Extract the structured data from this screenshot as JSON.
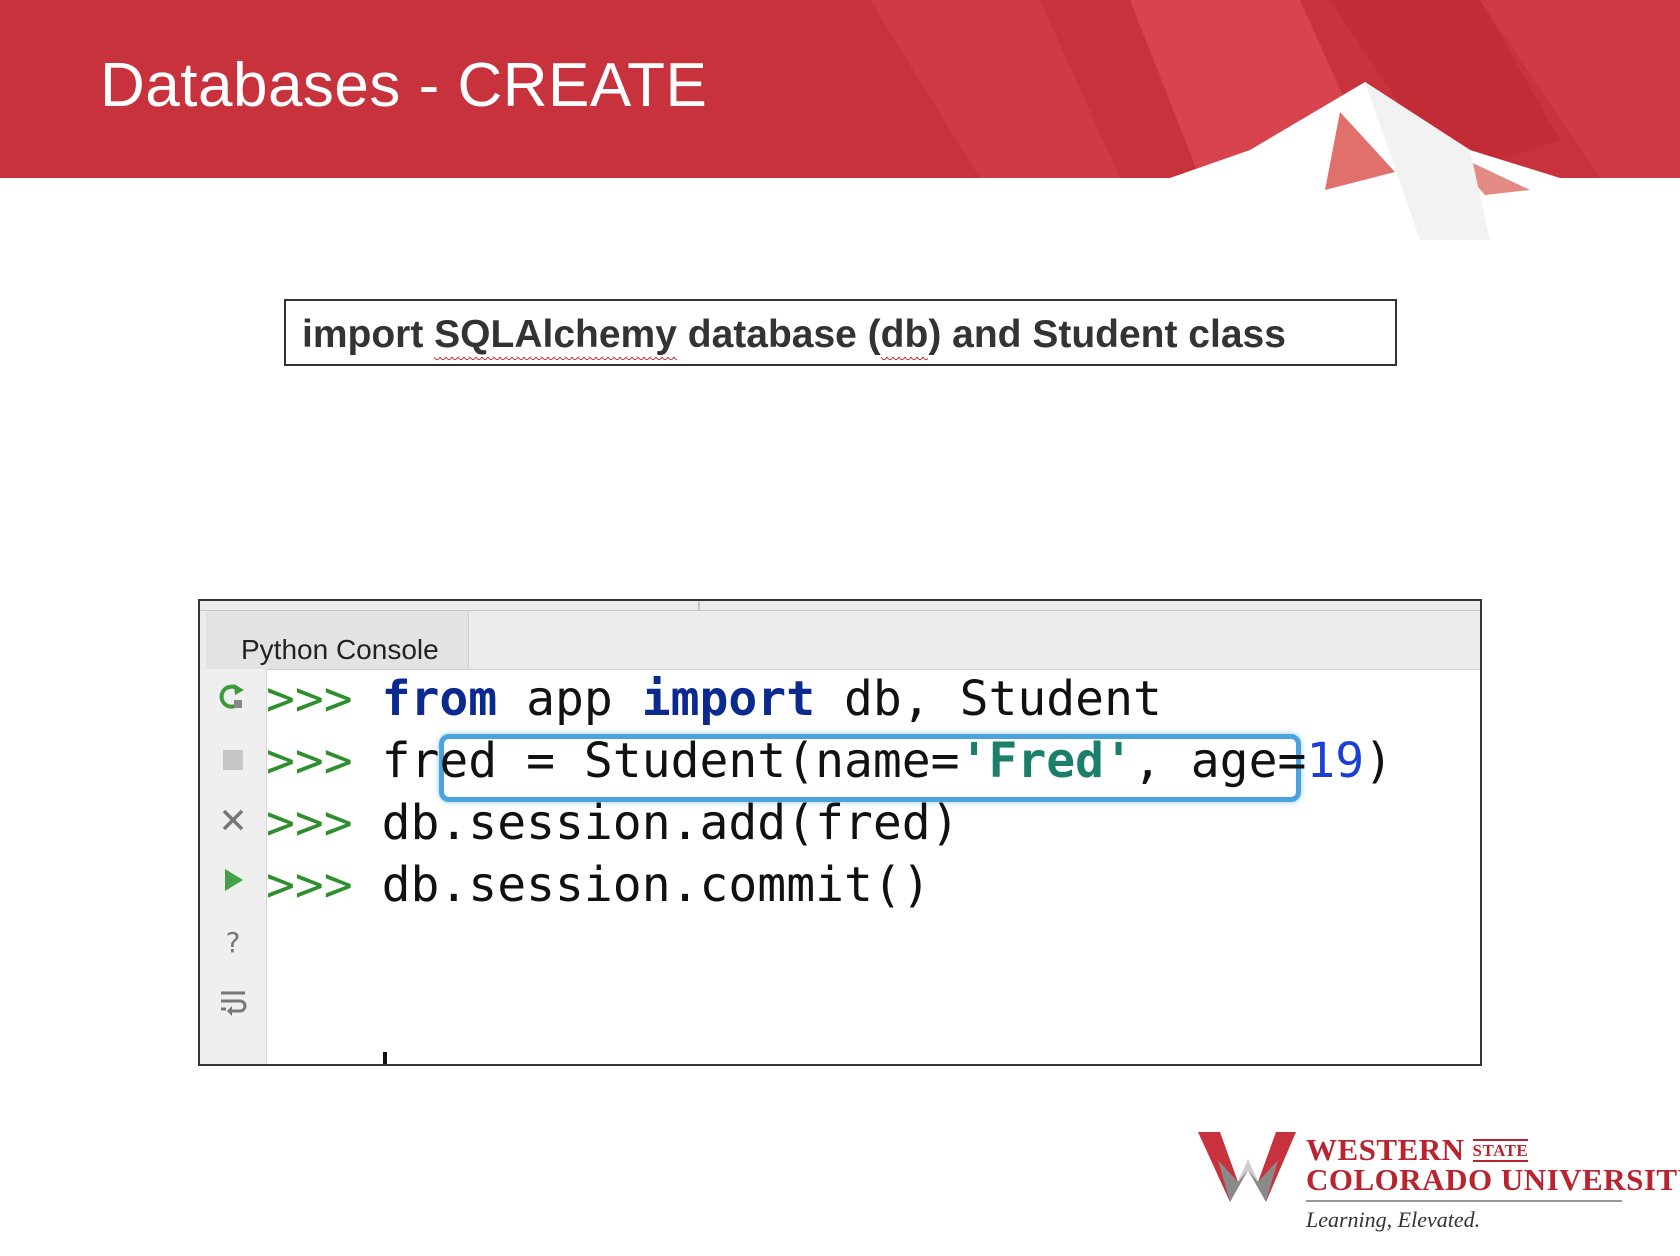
{
  "slide": {
    "title": "Databases - CREATE",
    "caption_parts": [
      "import ",
      "SQLAlchemy",
      " database (",
      "db",
      ") and Student class"
    ]
  },
  "console": {
    "tab_label": "Python Console",
    "prompt": ">>>",
    "lines": [
      [
        "from",
        " app ",
        "import",
        " db, Student"
      ],
      [
        "fred = Student(name=",
        "'Fred'",
        ", age=",
        "19",
        ")"
      ],
      [
        "db.session.add(fred)"
      ],
      [
        "db.session.commit()"
      ]
    ],
    "gutter_icons": [
      "rerun-icon",
      "stop-icon",
      "close-icon",
      "run-icon",
      "help-icon",
      "soft-wrap-icon"
    ]
  },
  "logo": {
    "line1": "WESTERN",
    "line1_small": "STATE",
    "line2": "COLORADO UNIVERSITY",
    "tagline": "Learning, Elevated."
  },
  "colors": {
    "banner_red": "#c8323c",
    "prompt_green": "#2f8f2f",
    "keyword_blue": "#0b2a8f",
    "highlight_blue": "#4aa3dc"
  }
}
